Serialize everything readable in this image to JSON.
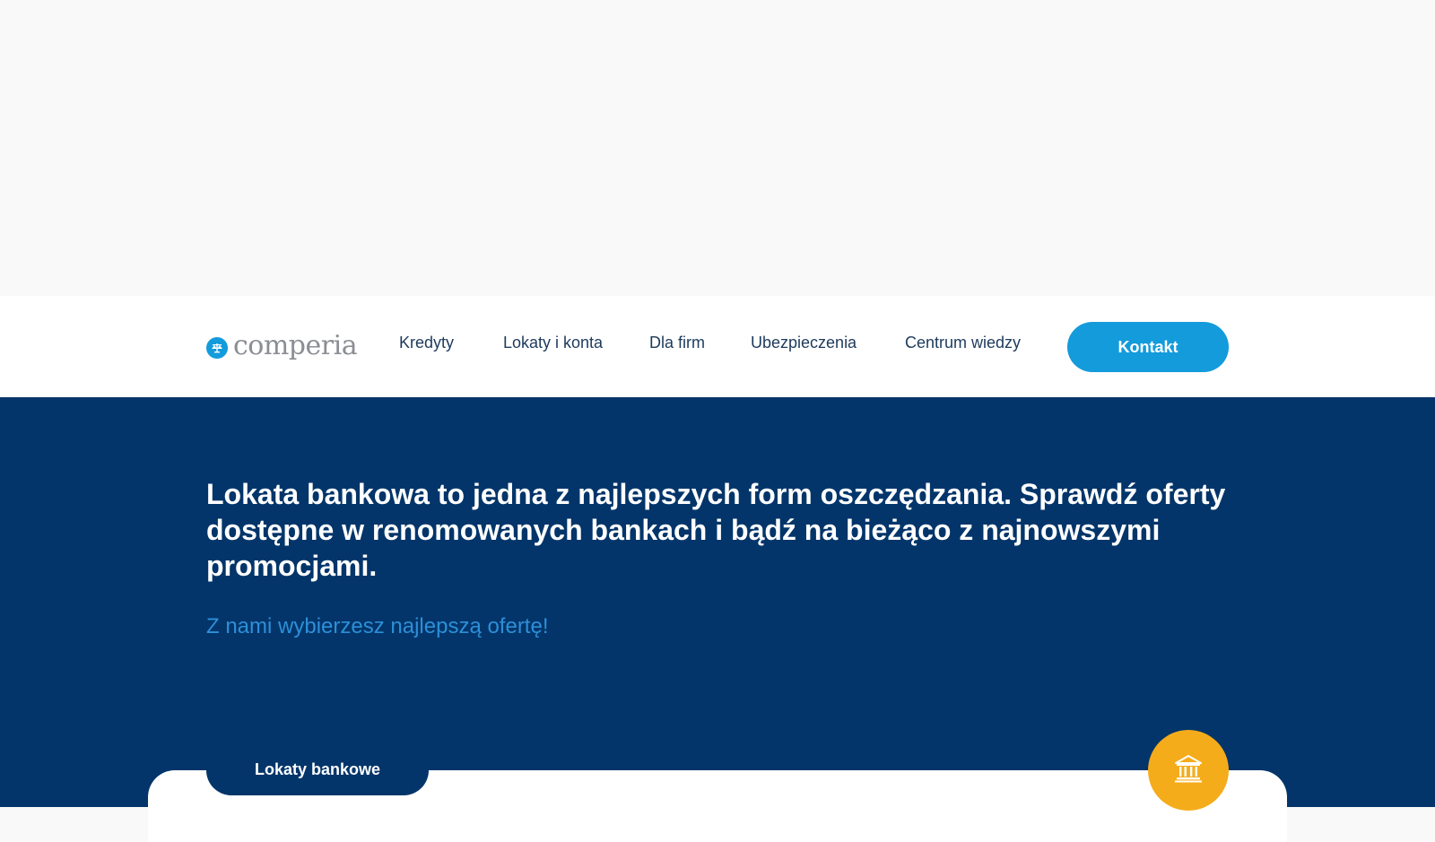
{
  "logo": {
    "text": "comperia",
    "icon": "scales-icon"
  },
  "nav": {
    "items": [
      {
        "label": "Kredyty"
      },
      {
        "label": "Lokaty i konta"
      },
      {
        "label": "Dla firm"
      },
      {
        "label": "Ubezpieczenia"
      },
      {
        "label": "Centrum wiedzy"
      }
    ],
    "contact_label": "Kontakt"
  },
  "hero": {
    "title": "Lokata bankowa to jedna z najlepszych form oszczędzania. Sprawdź oferty dostępne w renomowanych bankach i bądź na bieżąco z najnowszymi promocjami.",
    "subtitle": "Z nami wybierzesz najlepszą ofertę!"
  },
  "card": {
    "tab_label": "Lokaty bankowe",
    "badge_icon": "bank-icon"
  },
  "colors": {
    "brand_blue": "#139bdc",
    "navy": "#03356a",
    "accent_yellow": "#f5ac1b",
    "subtitle_blue": "#2d8fd8"
  }
}
